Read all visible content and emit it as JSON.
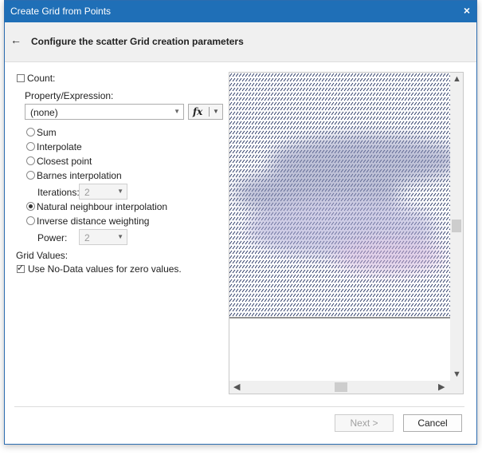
{
  "window": {
    "title": "Create Grid from Points",
    "close_glyph": "×"
  },
  "header": {
    "back_glyph": "←",
    "title": "Configure the scatter Grid creation parameters"
  },
  "form": {
    "count": {
      "label": "Count:",
      "checked": false
    },
    "property_label": "Property/Expression:",
    "property_value": "(none)",
    "fx_label": "fx",
    "methods": [
      {
        "label": "Sum",
        "selected": false
      },
      {
        "label": "Interpolate",
        "selected": false
      },
      {
        "label": "Closest point",
        "selected": false
      },
      {
        "label": "Barnes interpolation",
        "selected": false
      },
      {
        "label": "Natural neighbour interpolation",
        "selected": true
      },
      {
        "label": "Inverse distance weighting",
        "selected": false
      }
    ],
    "iterations": {
      "label": "Iterations:",
      "value": "2"
    },
    "power": {
      "label": "Power:",
      "value": "2"
    },
    "grid_values_label": "Grid Values:",
    "nodata": {
      "label": "Use No-Data values for zero values.",
      "checked": true
    }
  },
  "preview": {
    "hatch_color": "#1a2a5a",
    "blob_color": "#8a8fb8",
    "vertical_scroll_position": 0.45,
    "horizontal_scroll_position": 0.5
  },
  "footer": {
    "next_label": "Next >",
    "cancel_label": "Cancel"
  }
}
